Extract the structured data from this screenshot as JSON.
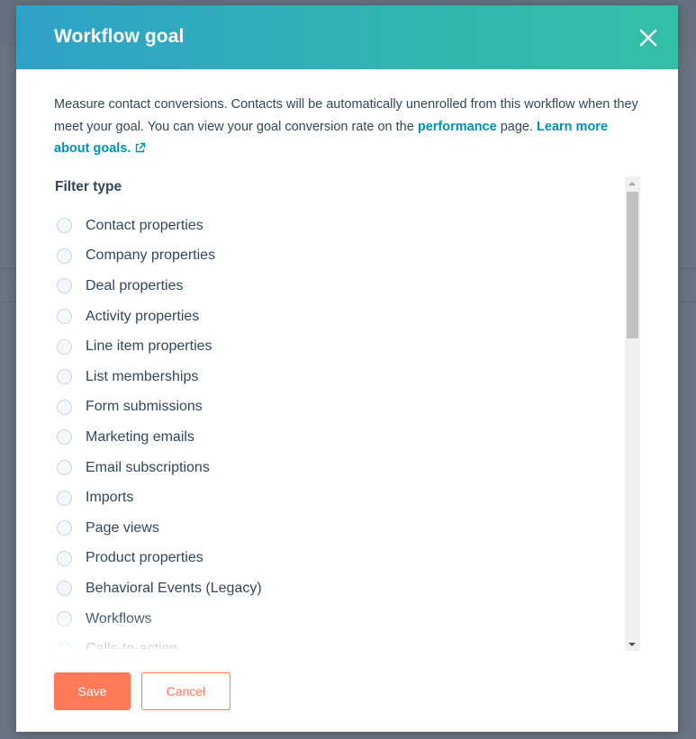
{
  "modal": {
    "title": "Workflow goal",
    "close_icon": "close-icon",
    "description_text": "Measure contact conversions. Contacts will be automatically unenrolled from this workflow when they meet your goal. You can view your goal conversion rate on the",
    "performance_link": "performance",
    "page_text": "page.",
    "learn_more_link": "Learn more about goals.",
    "external_link_icon": "external-link-icon",
    "filter_type_label": "Filter type",
    "filter_options": [
      {
        "label": "Contact properties"
      },
      {
        "label": "Company properties"
      },
      {
        "label": "Deal properties"
      },
      {
        "label": "Activity properties"
      },
      {
        "label": "Line item properties"
      },
      {
        "label": "List memberships"
      },
      {
        "label": "Form submissions"
      },
      {
        "label": "Marketing emails"
      },
      {
        "label": "Email subscriptions"
      },
      {
        "label": "Imports"
      },
      {
        "label": "Page views"
      },
      {
        "label": "Product properties"
      },
      {
        "label": "Behavioral Events (Legacy)"
      },
      {
        "label": "Workflows"
      },
      {
        "label": "Calls-to-action"
      }
    ],
    "save_label": "Save",
    "cancel_label": "Cancel"
  },
  "colors": {
    "header_gradient_start": "#2fa1c7",
    "header_gradient_end": "#35bfa6",
    "link": "#0091ae",
    "primary_button": "#ff7a59",
    "text": "#33475b"
  }
}
